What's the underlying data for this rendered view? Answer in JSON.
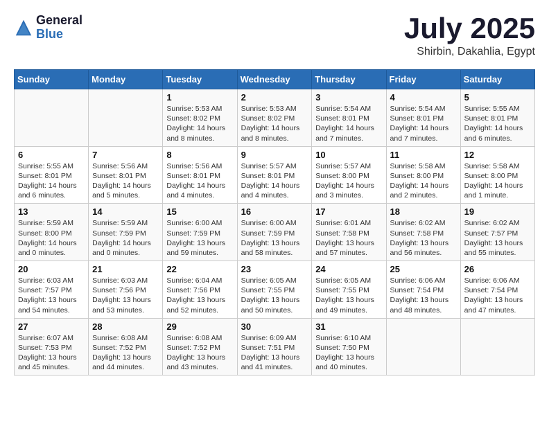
{
  "header": {
    "logo": {
      "general": "General",
      "blue": "Blue"
    },
    "title": "July 2025",
    "subtitle": "Shirbin, Dakahlia, Egypt"
  },
  "calendar": {
    "headers": [
      "Sunday",
      "Monday",
      "Tuesday",
      "Wednesday",
      "Thursday",
      "Friday",
      "Saturday"
    ],
    "weeks": [
      [
        {
          "day": "",
          "info": ""
        },
        {
          "day": "",
          "info": ""
        },
        {
          "day": "1",
          "info": "Sunrise: 5:53 AM\nSunset: 8:02 PM\nDaylight: 14 hours\nand 8 minutes."
        },
        {
          "day": "2",
          "info": "Sunrise: 5:53 AM\nSunset: 8:02 PM\nDaylight: 14 hours\nand 8 minutes."
        },
        {
          "day": "3",
          "info": "Sunrise: 5:54 AM\nSunset: 8:01 PM\nDaylight: 14 hours\nand 7 minutes."
        },
        {
          "day": "4",
          "info": "Sunrise: 5:54 AM\nSunset: 8:01 PM\nDaylight: 14 hours\nand 7 minutes."
        },
        {
          "day": "5",
          "info": "Sunrise: 5:55 AM\nSunset: 8:01 PM\nDaylight: 14 hours\nand 6 minutes."
        }
      ],
      [
        {
          "day": "6",
          "info": "Sunrise: 5:55 AM\nSunset: 8:01 PM\nDaylight: 14 hours\nand 6 minutes."
        },
        {
          "day": "7",
          "info": "Sunrise: 5:56 AM\nSunset: 8:01 PM\nDaylight: 14 hours\nand 5 minutes."
        },
        {
          "day": "8",
          "info": "Sunrise: 5:56 AM\nSunset: 8:01 PM\nDaylight: 14 hours\nand 4 minutes."
        },
        {
          "day": "9",
          "info": "Sunrise: 5:57 AM\nSunset: 8:01 PM\nDaylight: 14 hours\nand 4 minutes."
        },
        {
          "day": "10",
          "info": "Sunrise: 5:57 AM\nSunset: 8:00 PM\nDaylight: 14 hours\nand 3 minutes."
        },
        {
          "day": "11",
          "info": "Sunrise: 5:58 AM\nSunset: 8:00 PM\nDaylight: 14 hours\nand 2 minutes."
        },
        {
          "day": "12",
          "info": "Sunrise: 5:58 AM\nSunset: 8:00 PM\nDaylight: 14 hours\nand 1 minute."
        }
      ],
      [
        {
          "day": "13",
          "info": "Sunrise: 5:59 AM\nSunset: 8:00 PM\nDaylight: 14 hours\nand 0 minutes."
        },
        {
          "day": "14",
          "info": "Sunrise: 5:59 AM\nSunset: 7:59 PM\nDaylight: 14 hours\nand 0 minutes."
        },
        {
          "day": "15",
          "info": "Sunrise: 6:00 AM\nSunset: 7:59 PM\nDaylight: 13 hours\nand 59 minutes."
        },
        {
          "day": "16",
          "info": "Sunrise: 6:00 AM\nSunset: 7:59 PM\nDaylight: 13 hours\nand 58 minutes."
        },
        {
          "day": "17",
          "info": "Sunrise: 6:01 AM\nSunset: 7:58 PM\nDaylight: 13 hours\nand 57 minutes."
        },
        {
          "day": "18",
          "info": "Sunrise: 6:02 AM\nSunset: 7:58 PM\nDaylight: 13 hours\nand 56 minutes."
        },
        {
          "day": "19",
          "info": "Sunrise: 6:02 AM\nSunset: 7:57 PM\nDaylight: 13 hours\nand 55 minutes."
        }
      ],
      [
        {
          "day": "20",
          "info": "Sunrise: 6:03 AM\nSunset: 7:57 PM\nDaylight: 13 hours\nand 54 minutes."
        },
        {
          "day": "21",
          "info": "Sunrise: 6:03 AM\nSunset: 7:56 PM\nDaylight: 13 hours\nand 53 minutes."
        },
        {
          "day": "22",
          "info": "Sunrise: 6:04 AM\nSunset: 7:56 PM\nDaylight: 13 hours\nand 52 minutes."
        },
        {
          "day": "23",
          "info": "Sunrise: 6:05 AM\nSunset: 7:55 PM\nDaylight: 13 hours\nand 50 minutes."
        },
        {
          "day": "24",
          "info": "Sunrise: 6:05 AM\nSunset: 7:55 PM\nDaylight: 13 hours\nand 49 minutes."
        },
        {
          "day": "25",
          "info": "Sunrise: 6:06 AM\nSunset: 7:54 PM\nDaylight: 13 hours\nand 48 minutes."
        },
        {
          "day": "26",
          "info": "Sunrise: 6:06 AM\nSunset: 7:54 PM\nDaylight: 13 hours\nand 47 minutes."
        }
      ],
      [
        {
          "day": "27",
          "info": "Sunrise: 6:07 AM\nSunset: 7:53 PM\nDaylight: 13 hours\nand 45 minutes."
        },
        {
          "day": "28",
          "info": "Sunrise: 6:08 AM\nSunset: 7:52 PM\nDaylight: 13 hours\nand 44 minutes."
        },
        {
          "day": "29",
          "info": "Sunrise: 6:08 AM\nSunset: 7:52 PM\nDaylight: 13 hours\nand 43 minutes."
        },
        {
          "day": "30",
          "info": "Sunrise: 6:09 AM\nSunset: 7:51 PM\nDaylight: 13 hours\nand 41 minutes."
        },
        {
          "day": "31",
          "info": "Sunrise: 6:10 AM\nSunset: 7:50 PM\nDaylight: 13 hours\nand 40 minutes."
        },
        {
          "day": "",
          "info": ""
        },
        {
          "day": "",
          "info": ""
        }
      ]
    ]
  }
}
